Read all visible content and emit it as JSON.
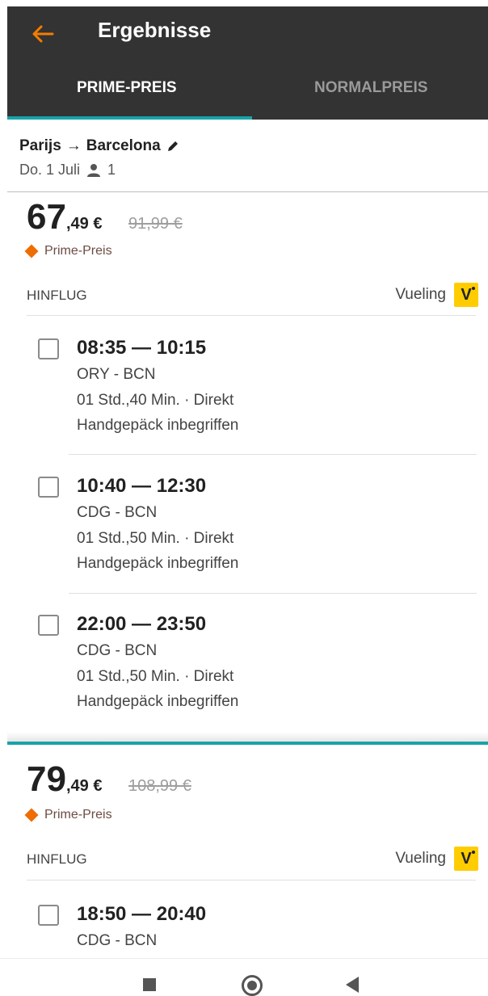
{
  "header": {
    "title": "Ergebnisse"
  },
  "tabs": [
    {
      "label": "PRIME-PREIS"
    },
    {
      "label": "NORMALPREIS"
    }
  ],
  "search": {
    "from": "Parijs",
    "arrow": "→",
    "to": "Barcelona",
    "date": "Do. 1 Juli",
    "passengers": "1"
  },
  "results": [
    {
      "price_main": "67",
      "price_cents": ",49 €",
      "price_old": "91,99 €",
      "badge": "Prime-Preis",
      "direction": "HINFLUG",
      "airline": "Vueling",
      "airline_logo": "V",
      "flights": [
        {
          "times": "08:35 — 10:15",
          "route": "ORY - BCN",
          "duration": "01 Std.,40 Min. · Direkt",
          "baggage": "Handgepäck inbegriffen"
        },
        {
          "times": "10:40 — 12:30",
          "route": "CDG - BCN",
          "duration": "01 Std.,50 Min. · Direkt",
          "baggage": "Handgepäck inbegriffen"
        },
        {
          "times": "22:00 — 23:50",
          "route": "CDG - BCN",
          "duration": "01 Std.,50 Min. · Direkt",
          "baggage": "Handgepäck inbegriffen"
        }
      ]
    },
    {
      "price_main": "79",
      "price_cents": ",49 €",
      "price_old": "108,99 €",
      "badge": "Prime-Preis",
      "direction": "HINFLUG",
      "airline": "Vueling",
      "airline_logo": "V",
      "flights": [
        {
          "times": "18:50 — 20:40",
          "route": "CDG - BCN"
        }
      ]
    }
  ],
  "icons": {
    "back": "arrow-left-icon",
    "edit": "pencil-icon",
    "person": "person-icon"
  },
  "colors": {
    "accent": "#18a3a8",
    "back_arrow": "#f57c00",
    "badge": "#ef6c00",
    "appbar": "#333333",
    "airline_logo": "#ffcc00"
  }
}
